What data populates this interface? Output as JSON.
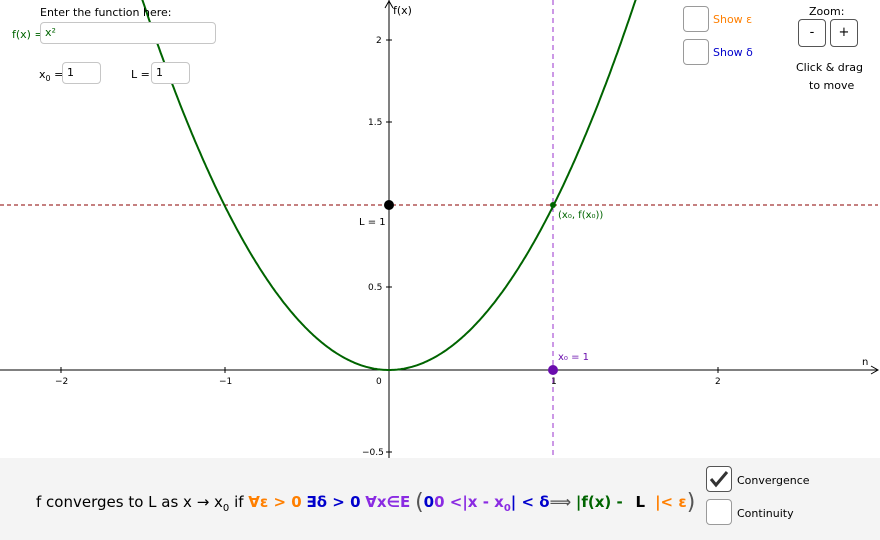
{
  "function_panel": {
    "prompt": "Enter the function here:",
    "f_label": "f(x) =",
    "f_value": "x²",
    "x0_label": "x",
    "x0_sub": "0",
    "x0_eq": " =",
    "x0_value": "1",
    "L_label": "L =",
    "L_value": "1"
  },
  "toggles": {
    "show_epsilon": "Show ε",
    "show_delta": "Show δ"
  },
  "zoom": {
    "title": "Zoom:",
    "minus": "-",
    "plus": "+",
    "hint_line1": "Click & drag",
    "hint_line2": "to move"
  },
  "graph": {
    "y_axis_label": "f(x)",
    "x_axis_label": "n",
    "x_ticks": [
      "−2",
      "−1",
      "0",
      "1",
      "2"
    ],
    "y_ticks": [
      "2",
      "1.5",
      "0.5",
      "−0.5"
    ],
    "L_point_label": "L = 1",
    "point_label": "(x₀, f(x₀))",
    "x0_point_label": "x₀ = 1",
    "colors": {
      "curve": "#006400",
      "horizontal_line": "#8b0000",
      "vertical_line": "#9932cc",
      "x0_point": "#6a0dad",
      "L_point": "#000000"
    }
  },
  "statement": {
    "prefix": "f converges to L as x → x",
    "prefix_sub": "0",
    "if": " if",
    "forall_eps": "∀ε > 0",
    "exists_delta": "∃δ > 0",
    "forall_x": "∀x∈E",
    "open_paren": "(",
    "cond_a": "0 <|x - x",
    "cond_sub": "0",
    "cond_b": "| < δ",
    "implies": "⟹",
    "fx": "|f(x) -",
    "L": "L",
    "lt_eps": "|< ε",
    "close_paren": ")"
  },
  "checkboxes": {
    "convergence": "Convergence",
    "convergence_checked": true,
    "continuity": "Continuity",
    "continuity_checked": false
  }
}
